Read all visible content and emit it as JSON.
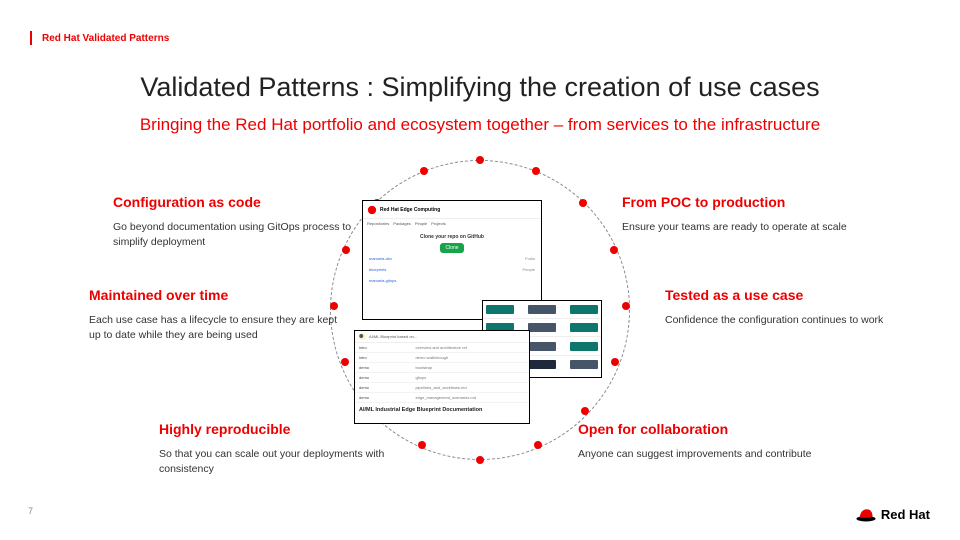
{
  "header": {
    "brand": "Red Hat Validated Patterns"
  },
  "title": "Validated Patterns : Simplifying the creation of use cases",
  "subtitle": "Bringing the Red Hat portfolio and ecosystem together – from services to the infrastructure",
  "features": {
    "left": [
      {
        "title": "Configuration as code",
        "body": "Go beyond documentation using GitOps process to simplify deployment"
      },
      {
        "title": "Maintained over time",
        "body": "Each use case has a lifecycle to ensure they are kept up to date while they are being used"
      },
      {
        "title": "Highly reproducible",
        "body": "So that you can scale out your deployments with consistency"
      }
    ],
    "right": [
      {
        "title": "From POC to production",
        "body": "Ensure your teams are ready to operate at scale"
      },
      {
        "title": "Tested as a use case",
        "body": "Confidence the configuration continues to work"
      },
      {
        "title": "Open for collaboration",
        "body": "Anyone can suggest improvements and contribute"
      }
    ]
  },
  "mockups": {
    "repo_name": "Red Hat Edge Computing",
    "repo_tagline": "Clone your repo on GitHub",
    "repo_button": "Clone",
    "doc_footer": "AI/ML Industrial Edge Blueprint Documentation"
  },
  "page_number": "7",
  "logo_text": "Red Hat",
  "colors": {
    "red": "#e00",
    "teal": "#0f766e",
    "gray": "#475569",
    "dark": "#1e293b"
  }
}
